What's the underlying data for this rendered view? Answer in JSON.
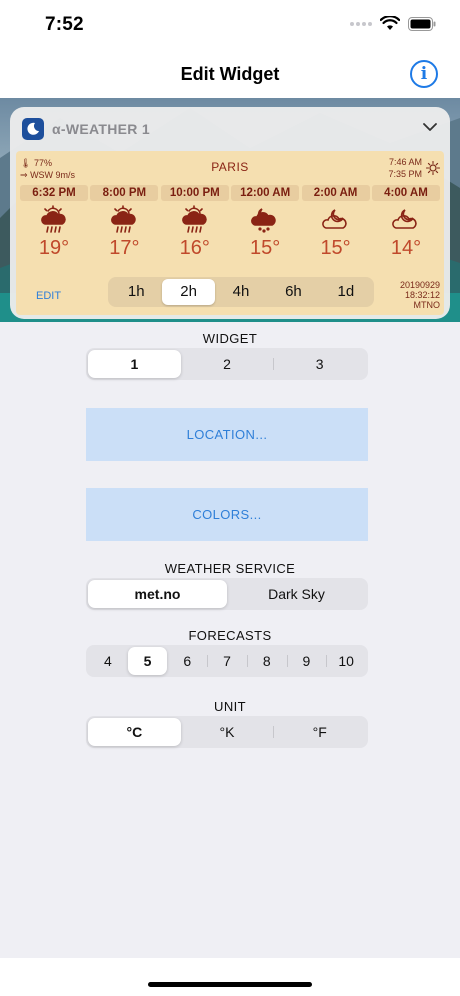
{
  "status_bar": {
    "time": "7:52"
  },
  "nav": {
    "title": "Edit Widget",
    "info_icon": "info-icon"
  },
  "widget": {
    "name": "α-WEATHER 1",
    "header_icon": "moon-icon",
    "city": "PARIS",
    "humidity": "77%",
    "wind": "WSW 9m/s",
    "sunrise": "7:46 AM",
    "sunset": "7:35 PM",
    "edit_label": "EDIT",
    "stamp_date": "20190929",
    "stamp_time": "18:32:12",
    "stamp_source": "MTNO",
    "forecast": [
      {
        "time": "6:32 PM",
        "icon": "sun-cloud-rain-icon",
        "temp": "19°"
      },
      {
        "time": "8:00 PM",
        "icon": "sun-cloud-rain-icon",
        "temp": "17°"
      },
      {
        "time": "10:00 PM",
        "icon": "sun-cloud-rain-icon",
        "temp": "16°"
      },
      {
        "time": "12:00 AM",
        "icon": "moon-cloud-drizzle-icon",
        "temp": "15°"
      },
      {
        "time": "2:00 AM",
        "icon": "moon-cloud-icon",
        "temp": "15°"
      },
      {
        "time": "4:00 AM",
        "icon": "moon-cloud-icon",
        "temp": "14°"
      }
    ],
    "intervals": [
      "1h",
      "2h",
      "4h",
      "6h",
      "1d"
    ],
    "interval_selected": "2h"
  },
  "widget_section": {
    "label": "WIDGET",
    "options": [
      "1",
      "2",
      "3"
    ],
    "selected": "1"
  },
  "location_button": "LOCATION...",
  "colors_button": "COLORS...",
  "service_section": {
    "label": "WEATHER SERVICE",
    "options": [
      "met.no",
      "Dark Sky"
    ],
    "selected": "met.no"
  },
  "forecasts_section": {
    "label": "FORECASTS",
    "options": [
      "4",
      "5",
      "6",
      "7",
      "8",
      "9",
      "10"
    ],
    "selected": "5"
  },
  "unit_section": {
    "label": "UNIT",
    "options": [
      "°C",
      "°K",
      "°F"
    ],
    "selected": "°C"
  },
  "colors": {
    "accent": "#1e7ae6",
    "button_bg": "#cbdff7",
    "temp": "#c0492b",
    "panel": "#f5dfb0"
  }
}
